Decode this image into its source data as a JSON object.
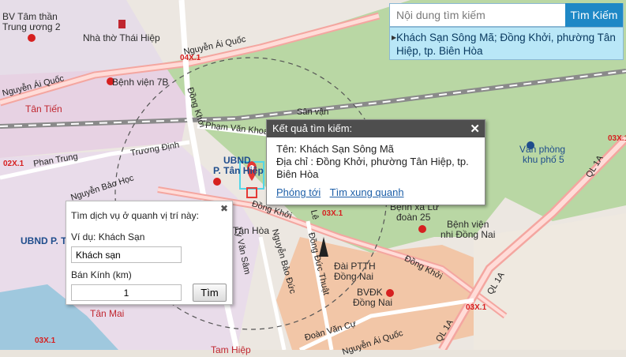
{
  "search": {
    "placeholder": "Nội dung tìm kiếm",
    "button_label": "Tìm Kiếm",
    "suggestion": "Khách Sạn Sông Mã; Đồng Khởi, phường Tân Hiệp, tp. Biên Hòa"
  },
  "result_popup": {
    "title": "Kết quả tìm kiếm:",
    "name": "Tên: Khách Sạn Sông Mã",
    "address": "Địa chỉ : Đồng Khởi, phường Tân Hiệp, tp. Biên Hòa",
    "zoom_link": "Phóng tới",
    "nearby_link": "Tìm xung quanh",
    "close_label": "✕"
  },
  "nearby_panel": {
    "title": "Tìm dịch vụ ở quanh vị trí này:",
    "example": "Ví dụ: Khách Sạn",
    "service_value": "Khách sạn",
    "radius_label": "Bán Kính (km)",
    "radius_value": "1",
    "search_button": "Tìm",
    "close_label": "✖"
  },
  "map_labels": {
    "bv_tam_than": "BV Tâm thần",
    "trung_uong": "Trung ương 2",
    "nha_tho": "Nhà thờ Thái Hiệp",
    "nguyen_ai_quoc_1": "Nguyễn Ái Quốc",
    "nguyen_ai_quoc_2": "Nguyễn Ái Quốc",
    "code_04x1": "04X.1",
    "benh_vien_7b": "Bệnh viện 7B",
    "tan_tien": "Tân Tiến",
    "dong_khoi_1": "Đồng Khởi",
    "pham_van_khoa": "Phạm Văn Khoa",
    "san_van": "Sân vận",
    "truong_dinh": "Trương Định",
    "code_02x1": "02X.1",
    "phan_trung": "Phan Trung",
    "ubnd_tan_hiep_1": "UBND",
    "ubnd_tan_hiep_2": "P. Tân Hiệp",
    "nguyen_bao_hoc": "Nguyễn Bảo Học",
    "van_phong_1": "Văn phòng",
    "van_phong_2": "khu phố 5",
    "ql1a_1": "QL 1A",
    "ql1a_2": "QL 1A",
    "ql1a_3": "QL 1A",
    "dong_khoi_2": "Đồng Khởi",
    "dong_khoi_3": "Đồng Khởi",
    "code_03x1_1": "03X.1",
    "code_03x1_2": "03X.1",
    "code_03x1_3": "03X.1",
    "code_03x1_4": "03X.1",
    "benh_xa_luu_1": "Bệnh xá Lữ",
    "benh_xa_luu_2": "đoàn 25",
    "benh_vien_nhi_1": "Bệnh viện",
    "benh_vien_nhi_2": "nhi Đồng Nai",
    "ubnd_p": "UBND P. Tân",
    "tan_hoa": "Tân Hòa",
    "ly_van_sam": "Lý Văn Sâm",
    "nguyen_bao_duc": "Nguyễn Bảo Đức",
    "dong_duc_thuat": "Đồng Đức Thuật",
    "le": "Lê",
    "dai_ptth_1": "Đài PTTH",
    "dai_ptth_2": "Đồng Nai",
    "bvdk_1": "BVĐK",
    "bvdk_2": "Đồng Nai",
    "doan_van_cu": "Đoàn Văn Cự",
    "tan_mai_1": "Tân Mai",
    "tan_mai_2": "Tam Hiệp",
    "nguyen_ai_quoc_3": "Nguyễn Ái Quốc"
  },
  "colors": {
    "accent": "#1e88c6",
    "suggestion_bg": "#b9e7f7",
    "popup_header": "#4e4e4e",
    "marker": "#e53935",
    "highlight": "#54d6e8"
  }
}
